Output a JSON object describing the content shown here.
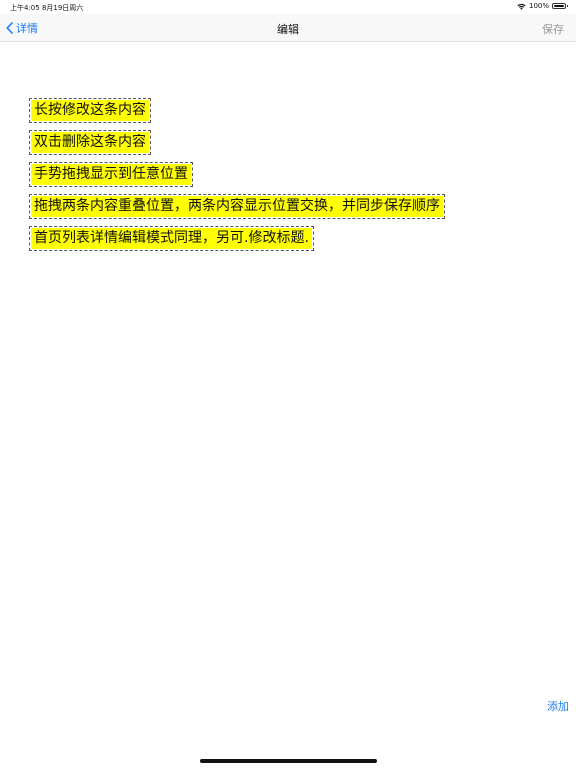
{
  "status_bar": {
    "time_date": "上午4:05   8月19日周六",
    "battery_text": "100%",
    "battery_level": 1.0
  },
  "nav": {
    "back_label": "详情",
    "title": "编辑",
    "save_label": "保存"
  },
  "items": [
    "长按修改这条内容",
    "双击删除这条内容",
    "手势拖拽显示到任意位置",
    "拖拽两条内容重叠位置，两条内容显示位置交换，并同步保存顺序",
    "首页列表详情编辑模式同理，另可.修改标题."
  ],
  "footer": {
    "add_label": "添加"
  },
  "colors": {
    "accent": "#1a7cf5",
    "highlight": "#ffff00",
    "disabled": "#9a9a9a"
  }
}
